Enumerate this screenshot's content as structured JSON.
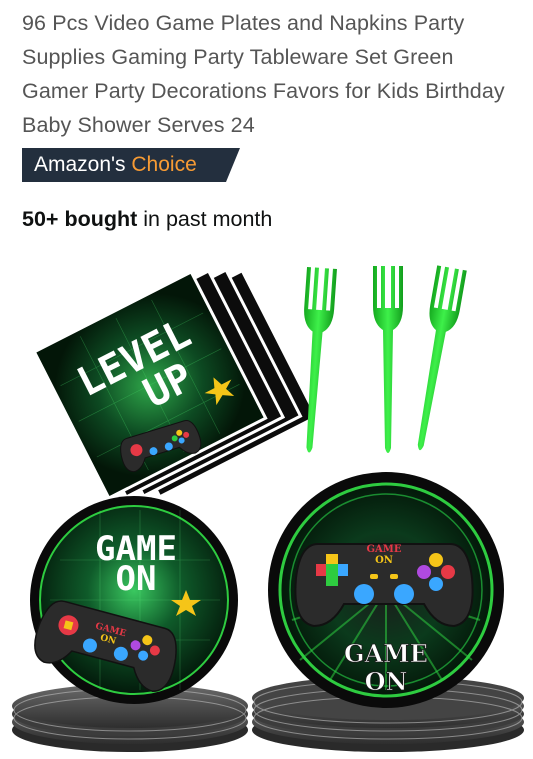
{
  "product": {
    "title": "96 Pcs Video Game Plates and Napkins Party Supplies Gaming Party Tableware Set Green Gamer Party Decorations Favors for Kids Birthday Baby Shower Serves 24",
    "badge": {
      "prefix": "Amazon's",
      "accent": "Choice",
      "bg_color": "#232f3e",
      "accent_color": "#f79b34"
    },
    "social_proof": {
      "count": "50+ bought",
      "suffix": "in past month"
    },
    "image": {
      "napkin_text_line1": "LEVEL",
      "napkin_text_line2": "UP",
      "small_plate_line1": "GAME",
      "small_plate_line2": "ON",
      "large_plate_line1": "GAME",
      "large_plate_line2": "ON",
      "controller_label_line1": "GAME",
      "controller_label_line2": "ON",
      "fork_color": "#22d12e"
    }
  }
}
